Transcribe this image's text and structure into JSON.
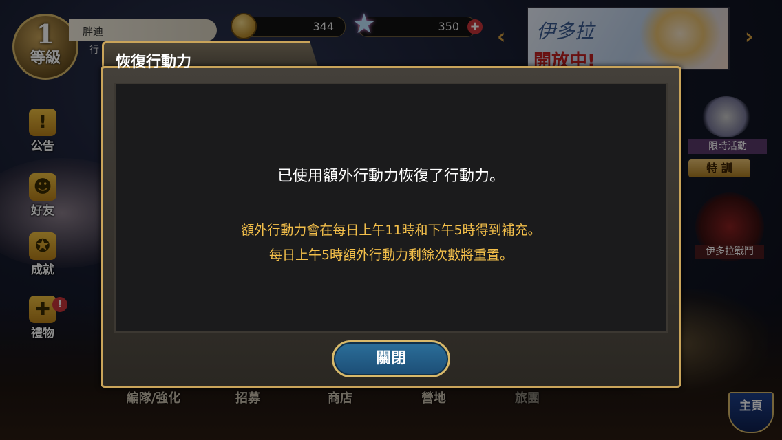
{
  "hud": {
    "level_number": "1",
    "level_label": "等級",
    "player_name": "胖迪",
    "player_sub": "行",
    "coins": "344",
    "stars": "350",
    "banner_title": "伊多拉",
    "banner_sub": "開放中!"
  },
  "sidebar": {
    "items": [
      {
        "label": "公告",
        "icon": "notice-icon"
      },
      {
        "label": "好友",
        "icon": "friends-icon"
      },
      {
        "label": "成就",
        "icon": "achievement-icon"
      },
      {
        "label": "禮物",
        "icon": "gift-icon",
        "badge": "!"
      }
    ]
  },
  "right_panel": {
    "event_label": "限時活動",
    "event_button": "特 訓",
    "raid_label": "伊多拉戰鬥"
  },
  "bottom_nav": {
    "items": [
      "編隊/強化",
      "招募",
      "商店",
      "營地",
      "旅團"
    ],
    "home_label": "主頁"
  },
  "dialog": {
    "title": "恢復行動力",
    "message": "已使用額外行動力恢復了行動力。",
    "note_line1": "額外行動力會在每日上午11時和下午5時得到補充。",
    "note_line2": "每日上午5時額外行動力剩餘次數將重置。",
    "close_label": "關閉"
  },
  "colors": {
    "accent_gold": "#c9a45a",
    "note_text": "#f3bf4a",
    "button_blue": "#2b6f9a"
  }
}
